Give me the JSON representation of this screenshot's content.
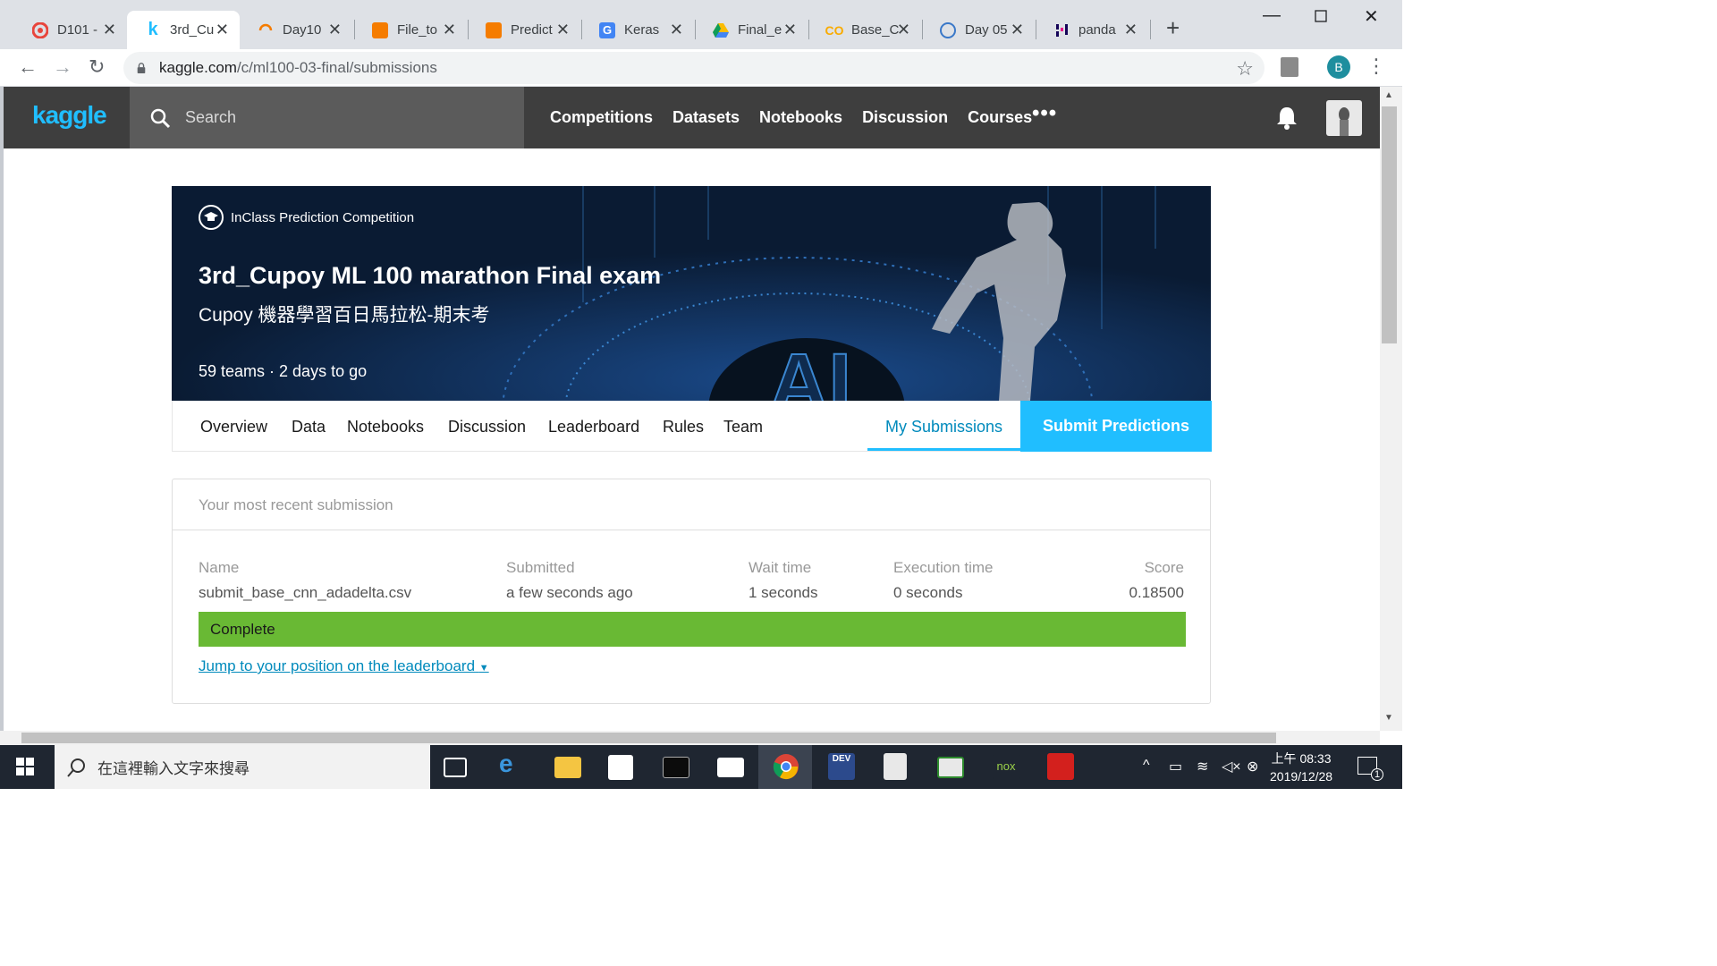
{
  "browser": {
    "tabs": [
      {
        "label": "D101 -",
        "icon": "cupoy-icon",
        "color": "#e8453c"
      },
      {
        "label": "3rd_Cu",
        "icon": "kaggle-k-icon",
        "color": "#20beff"
      },
      {
        "label": "Day10",
        "icon": "loading-spinner-icon",
        "color": "#f57c00"
      },
      {
        "label": "File_to",
        "icon": "notebook-icon",
        "color": "#f57c00"
      },
      {
        "label": "Predict",
        "icon": "notebook-icon",
        "color": "#f57c00"
      },
      {
        "label": "Keras",
        "icon": "keras-icon",
        "color": "#4285f4"
      },
      {
        "label": "Final_e",
        "icon": "google-drive-icon",
        "color": "#fbbc04"
      },
      {
        "label": "Base_C",
        "icon": "colab-icon",
        "color": "#f9ab00"
      },
      {
        "label": "Day 05",
        "icon": "globe-icon",
        "color": "#3a78c8"
      },
      {
        "label": "panda",
        "icon": "pandas-icon",
        "color": "#150458"
      }
    ],
    "active_tab_index": 1,
    "url_host": "kaggle.com",
    "url_path": "/c/ml100-03-final/submissions",
    "profile_letter": "B"
  },
  "kaggle": {
    "logo": "kaggle",
    "search_label": "Search",
    "nav": [
      "Competitions",
      "Datasets",
      "Notebooks",
      "Discussion",
      "Courses"
    ],
    "more": "•••"
  },
  "competition": {
    "type": "InClass Prediction Competition",
    "title": "3rd_Cupoy ML 100 marathon Final exam",
    "subtitle": "Cupoy 機器學習百日馬拉松-期末考",
    "meta": "59 teams  ·  2 days to go",
    "hero_text": "AI",
    "tabs": [
      "Overview",
      "Data",
      "Notebooks",
      "Discussion",
      "Leaderboard",
      "Rules",
      "Team"
    ],
    "my_submissions": "My Submissions",
    "submit_predictions": "Submit Predictions"
  },
  "submission": {
    "heading": "Your most recent submission",
    "name_label": "Name",
    "name": "submit_base_cnn_adadelta.csv",
    "submitted_label": "Submitted",
    "submitted": "a few seconds ago",
    "wait_label": "Wait time",
    "wait": "1 seconds",
    "exec_label": "Execution time",
    "exec": "0 seconds",
    "score_label": "Score",
    "score": "0.18500",
    "status": "Complete",
    "status_color": "#69b934",
    "jump_link": "Jump to your position on the leaderboard"
  },
  "taskbar": {
    "search_placeholder": "在這裡輸入文字來搜尋",
    "clock_period": "上午 08:33",
    "date": "2019/12/28",
    "notifications": "1"
  }
}
